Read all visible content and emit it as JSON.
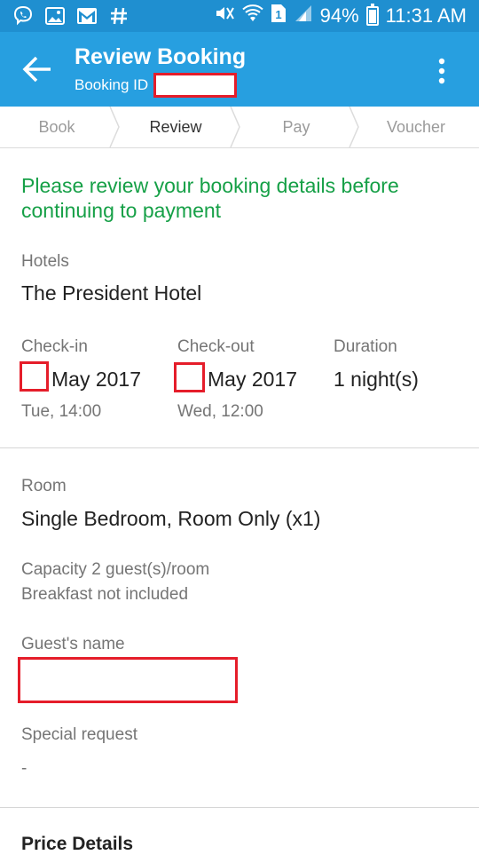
{
  "status_bar": {
    "battery": "94%",
    "time": "11:31 AM",
    "icons": [
      "viber-icon",
      "gallery-icon",
      "gmail-icon",
      "hash-icon",
      "mute-icon",
      "wifi-icon",
      "sim1-icon",
      "signal-icon",
      "battery-icon"
    ]
  },
  "toolbar": {
    "title": "Review Booking",
    "booking_id_label": "Booking ID",
    "booking_id_value": "",
    "bg_color": "#279fe0"
  },
  "steps": [
    {
      "label": "Book",
      "active": false
    },
    {
      "label": "Review",
      "active": true
    },
    {
      "label": "Pay",
      "active": false
    },
    {
      "label": "Voucher",
      "active": false
    }
  ],
  "notice": "Please review your booking details before continuing to payment",
  "hotel": {
    "label": "Hotels",
    "name": "The President Hotel"
  },
  "stay": {
    "checkin_label": "Check-in",
    "checkin_date": "May 2017",
    "checkin_time": "Tue, 14:00",
    "checkout_label": "Check-out",
    "checkout_date": "May 2017",
    "checkout_time": "Wed, 12:00",
    "duration_label": "Duration",
    "duration_value": "1 night(s)"
  },
  "room": {
    "label": "Room",
    "name": "Single Bedroom, Room Only (x1)",
    "capacity": "Capacity 2 guest(s)/room",
    "breakfast": "Breakfast not included"
  },
  "guest": {
    "label": "Guest's name",
    "value": ""
  },
  "special_request": {
    "label": "Special request",
    "value": "-"
  },
  "price_details": {
    "title": "Price Details"
  },
  "colors": {
    "notice_green": "#16a047",
    "redaction_red": "#e51d2a"
  }
}
